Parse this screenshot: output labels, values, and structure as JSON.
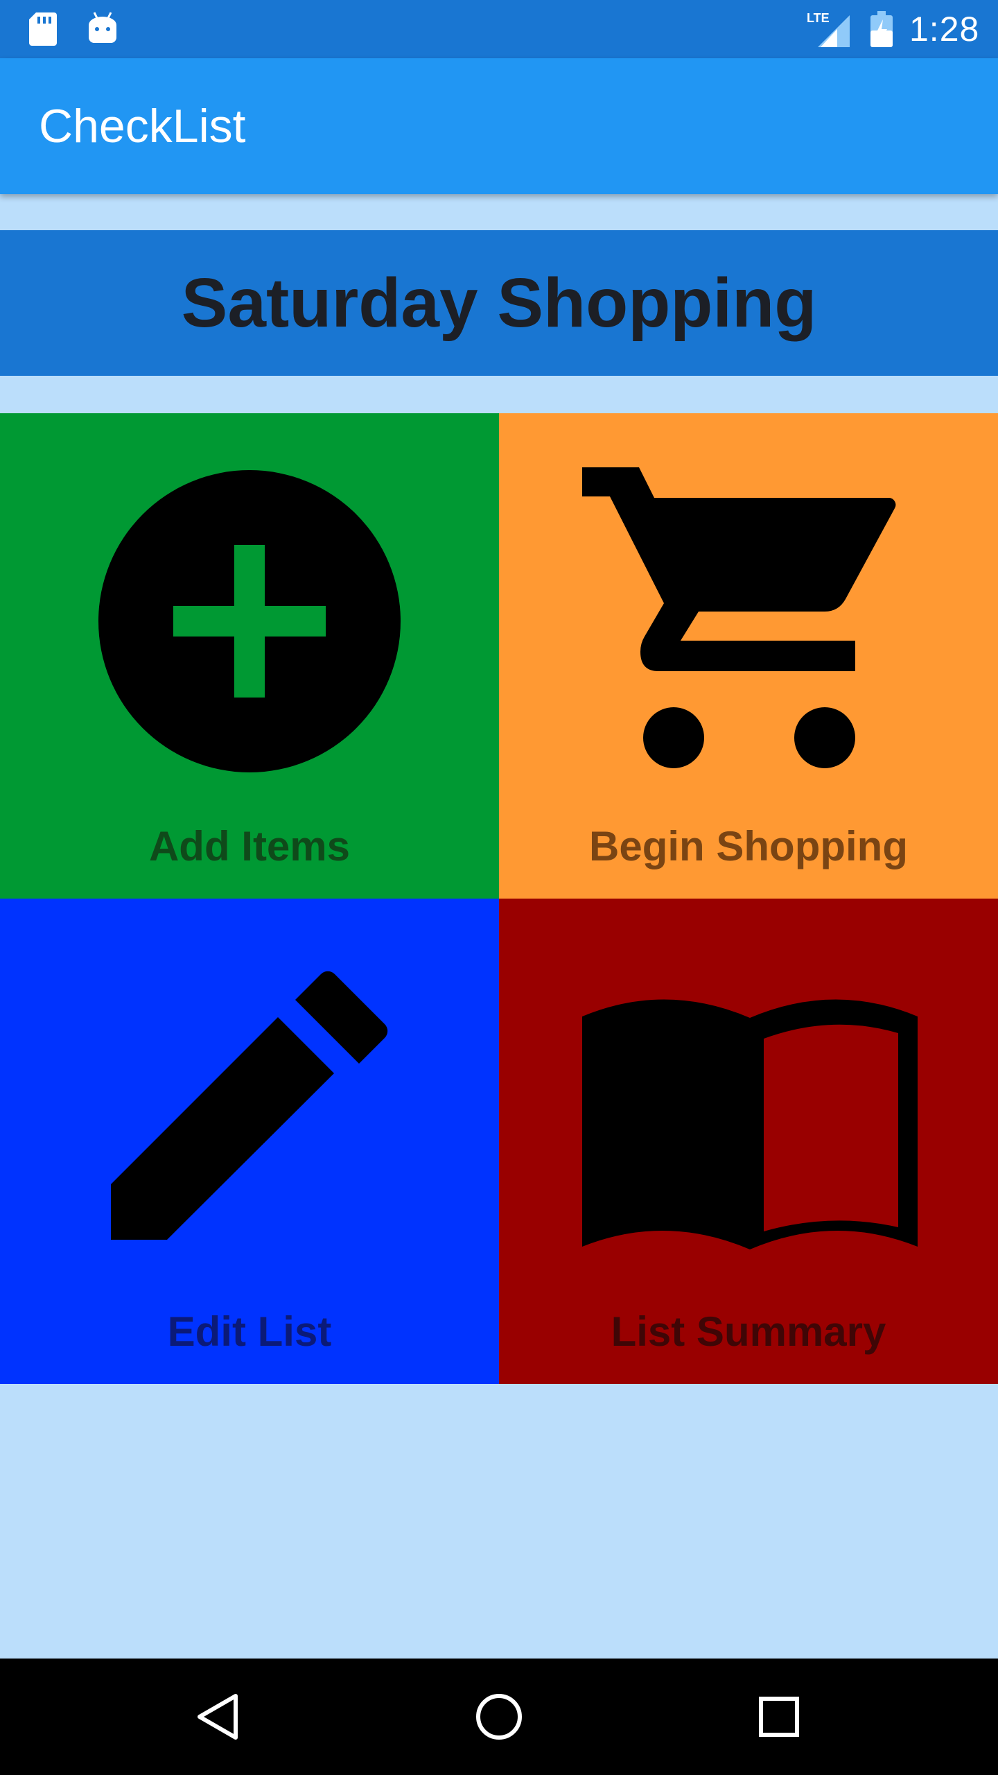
{
  "status_bar": {
    "time": "1:28",
    "network": "LTE",
    "icons": [
      "sd-card-icon",
      "android-icon",
      "lte-signal-icon",
      "battery-charging-icon"
    ]
  },
  "app_bar": {
    "title": "CheckList",
    "color": "#2196f3"
  },
  "list": {
    "title": "Saturday Shopping"
  },
  "tiles": [
    {
      "label": "Add Items",
      "icon": "add-circle-icon",
      "color": "#009933"
    },
    {
      "label": "Begin Shopping",
      "icon": "shopping-cart-icon",
      "color": "#ff9933"
    },
    {
      "label": "Edit List",
      "icon": "pencil-icon",
      "color": "#0033ff"
    },
    {
      "label": "List Summary",
      "icon": "open-book-icon",
      "color": "#990000"
    }
  ],
  "nav_bar": {
    "icons": [
      "back-icon",
      "home-icon",
      "recents-icon"
    ]
  },
  "colors": {
    "background": "#bbdefb",
    "status_bar": "#1976d2",
    "banner": "#1976d2"
  }
}
